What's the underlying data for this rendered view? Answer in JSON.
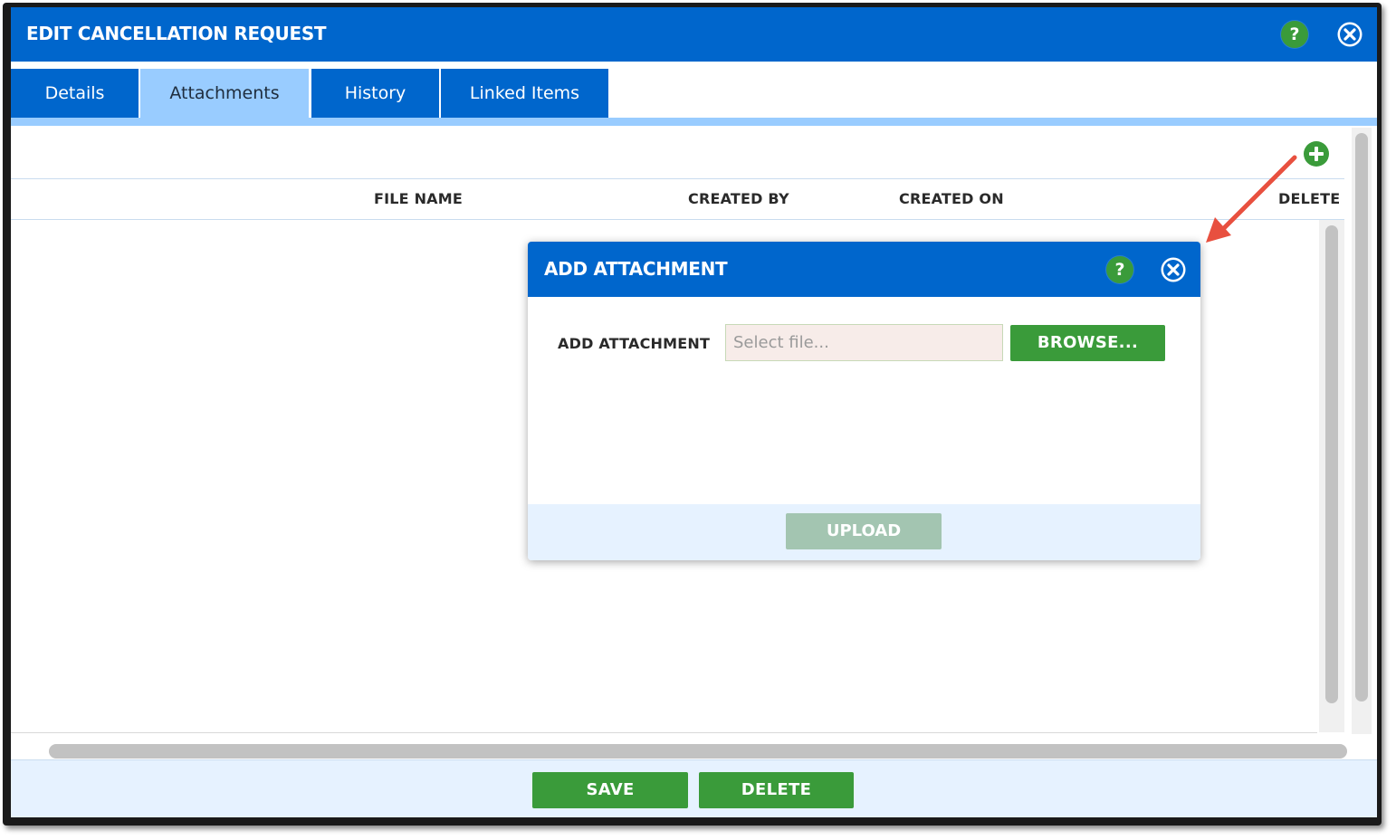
{
  "window": {
    "title": "EDIT CANCELLATION REQUEST",
    "help_icon": "question-icon",
    "help_label": "?",
    "close_icon": "close-circle-icon"
  },
  "tabs": [
    {
      "label": "Details",
      "active": false
    },
    {
      "label": "Attachments",
      "active": true
    },
    {
      "label": "History",
      "active": false
    },
    {
      "label": "Linked Items",
      "active": false
    }
  ],
  "grid": {
    "add_icon": "plus-circle-icon",
    "columns": [
      "FILE NAME",
      "CREATED BY",
      "CREATED ON",
      "DELETE"
    ],
    "rows": []
  },
  "footer": {
    "save_label": "SAVE",
    "delete_label": "DELETE"
  },
  "modal": {
    "title": "ADD ATTACHMENT",
    "help_label": "?",
    "field_label": "ADD ATTACHMENT",
    "file_placeholder": "Select file...",
    "browse_label": "BROWSE...",
    "upload_label": "UPLOAD",
    "upload_enabled": false
  },
  "colors": {
    "primary_blue": "#0066cc",
    "tab_active": "#99ccff",
    "green": "#3a9b3a",
    "disabled_green": "#a3c5b1",
    "annotation_arrow": "#e8503f"
  }
}
